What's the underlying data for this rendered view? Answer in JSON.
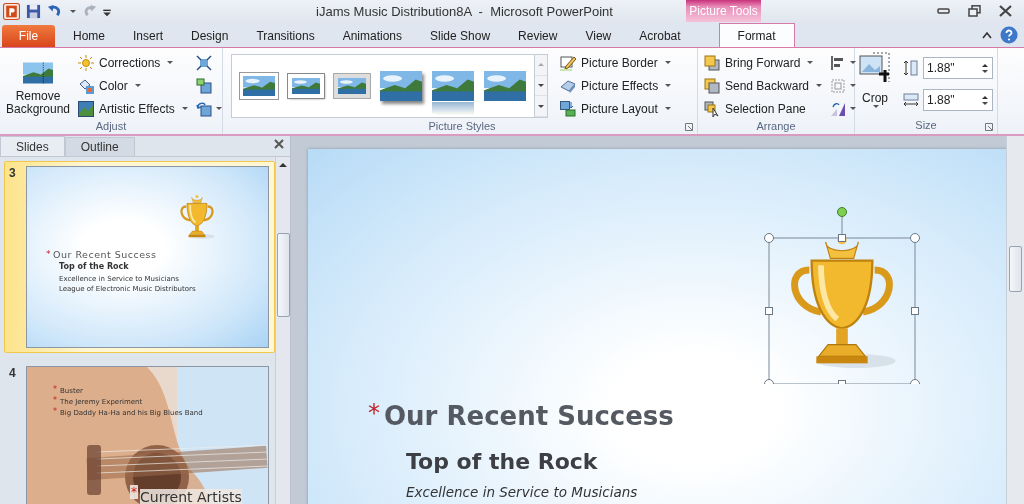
{
  "window": {
    "title": "iJams Music Distribution8A  -  Microsoft PowerPoint",
    "contextual_tab": "Picture Tools"
  },
  "tabs": [
    {
      "label": "File",
      "kind": "file",
      "selected": false
    },
    {
      "label": "Home",
      "kind": "tab",
      "selected": false
    },
    {
      "label": "Insert",
      "kind": "tab",
      "selected": false
    },
    {
      "label": "Design",
      "kind": "tab",
      "selected": false
    },
    {
      "label": "Transitions",
      "kind": "tab",
      "selected": false
    },
    {
      "label": "Animations",
      "kind": "tab",
      "selected": false
    },
    {
      "label": "Slide Show",
      "kind": "tab",
      "selected": false
    },
    {
      "label": "Review",
      "kind": "tab",
      "selected": false
    },
    {
      "label": "View",
      "kind": "tab",
      "selected": false
    },
    {
      "label": "Acrobat",
      "kind": "tab",
      "selected": false
    },
    {
      "label": "Format",
      "kind": "contextual",
      "selected": true
    }
  ],
  "ribbon": {
    "adjust": {
      "label": "Adjust",
      "large_button": "Remove Background",
      "buttons": [
        {
          "label": "Corrections",
          "kind": "sun"
        },
        {
          "label": "Color",
          "kind": "color"
        },
        {
          "label": "Artistic Effects",
          "kind": "artistic"
        }
      ]
    },
    "picture_styles": {
      "label": "Picture Styles",
      "styles": [
        {
          "kind": "frame"
        },
        {
          "kind": "thick"
        },
        {
          "kind": "matte"
        },
        {
          "kind": "shadow"
        },
        {
          "kind": "reflect"
        },
        {
          "kind": "soft"
        }
      ],
      "buttons": [
        {
          "label": "Picture Border",
          "kind": "border"
        },
        {
          "label": "Picture Effects",
          "kind": "effects"
        },
        {
          "label": "Picture Layout",
          "kind": "layout"
        }
      ]
    },
    "arrange": {
      "label": "Arrange",
      "buttons": [
        {
          "label": "Bring Forward",
          "kind": "forward"
        },
        {
          "label": "Send Backward",
          "kind": "backward"
        },
        {
          "label": "Selection Pane",
          "kind": "pane"
        }
      ]
    },
    "size": {
      "label": "Size",
      "crop": "Crop",
      "height": "1.88\"",
      "width": "1.88\""
    }
  },
  "slides_pane": {
    "tabs": [
      {
        "label": "Slides",
        "selected": true
      },
      {
        "label": "Outline",
        "selected": false
      }
    ],
    "thumbnails": [
      {
        "number": "3",
        "selected": true,
        "kind": "success",
        "title_marker": "*",
        "title": "Our Recent Success",
        "subtitle": "Top of the Rock",
        "lines": [
          {
            "text": "Excellence in Service to Musicians"
          },
          {
            "text": "League of Electronic Music Distributors"
          }
        ]
      },
      {
        "number": "4",
        "selected": false,
        "kind": "artists",
        "title_marker": "*",
        "title": "Current Artists",
        "lines": [
          {
            "marker": "*",
            "text": "Buster"
          },
          {
            "marker": "*",
            "text": "The Jeremy Experiment"
          },
          {
            "marker": "*",
            "text": "Big Daddy Ha-Ha and his Big Blues Band"
          }
        ]
      }
    ]
  },
  "slide": {
    "title_marker": "*",
    "title": "Our Recent Success",
    "subtitle": "Top of the Rock",
    "line": "Excellence in Service to Musicians",
    "image_selected": true
  }
}
